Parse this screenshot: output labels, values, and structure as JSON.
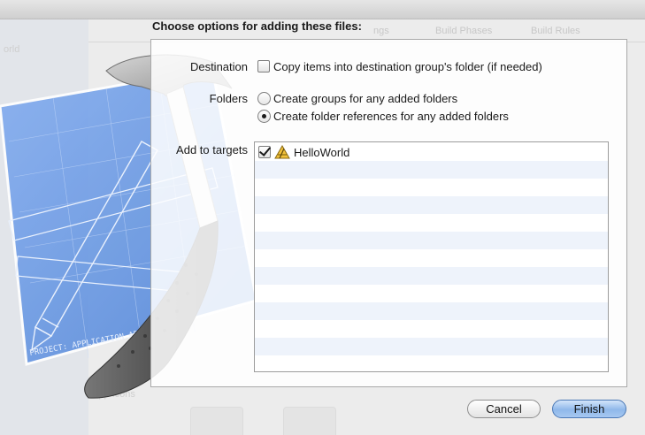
{
  "sheet": {
    "title": "Choose options for adding these files:",
    "destination": {
      "label": "Destination",
      "checkbox_label": "Copy items into destination group's folder (if needed)",
      "checked": false
    },
    "folders": {
      "label": "Folders",
      "options": [
        {
          "label": "Create groups for any added folders",
          "selected": false
        },
        {
          "label": "Create folder references for any added folders",
          "selected": true
        }
      ]
    },
    "targets": {
      "label": "Add to targets",
      "items": [
        {
          "name": "HelloWorld",
          "checked": true,
          "icon": "app-target-icon"
        }
      ]
    },
    "buttons": {
      "cancel": "Cancel",
      "finish": "Finish"
    }
  },
  "background": {
    "sidebar_text": "orld",
    "tabs": [
      "ngs",
      "Build Phases",
      "Build Rules"
    ],
    "bottom_label": "App Icons"
  },
  "artwork": {
    "blueprint_label": "PROJECT: APPLICATION.APP"
  },
  "colors": {
    "finish_button": "#8fb8ea",
    "blueprint": "#5b8fe0",
    "stripe": "#eef3fb"
  }
}
